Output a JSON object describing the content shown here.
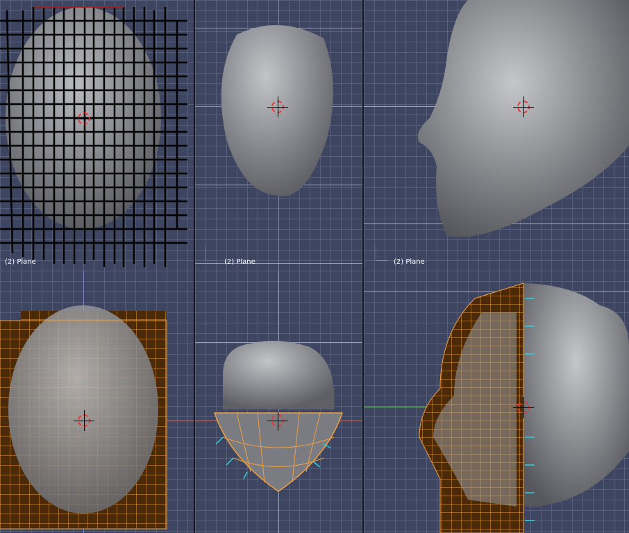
{
  "viewports": [
    {
      "label": "(2) Plane",
      "view": "front"
    },
    {
      "label": "(2) Plane",
      "view": "top",
      "axis": "x"
    },
    {
      "label": "(2) Plane",
      "view": "side",
      "axis": "y"
    },
    {
      "view": "front-edit"
    },
    {
      "view": "top-edit"
    },
    {
      "view": "side-edit"
    }
  ],
  "colors": {
    "grid_bg": "#3d4561",
    "mesh_orange": "#f0a040",
    "mesh_face": "#4a2a08",
    "normals": "#30d0e0",
    "head": "#9a9ca2"
  }
}
